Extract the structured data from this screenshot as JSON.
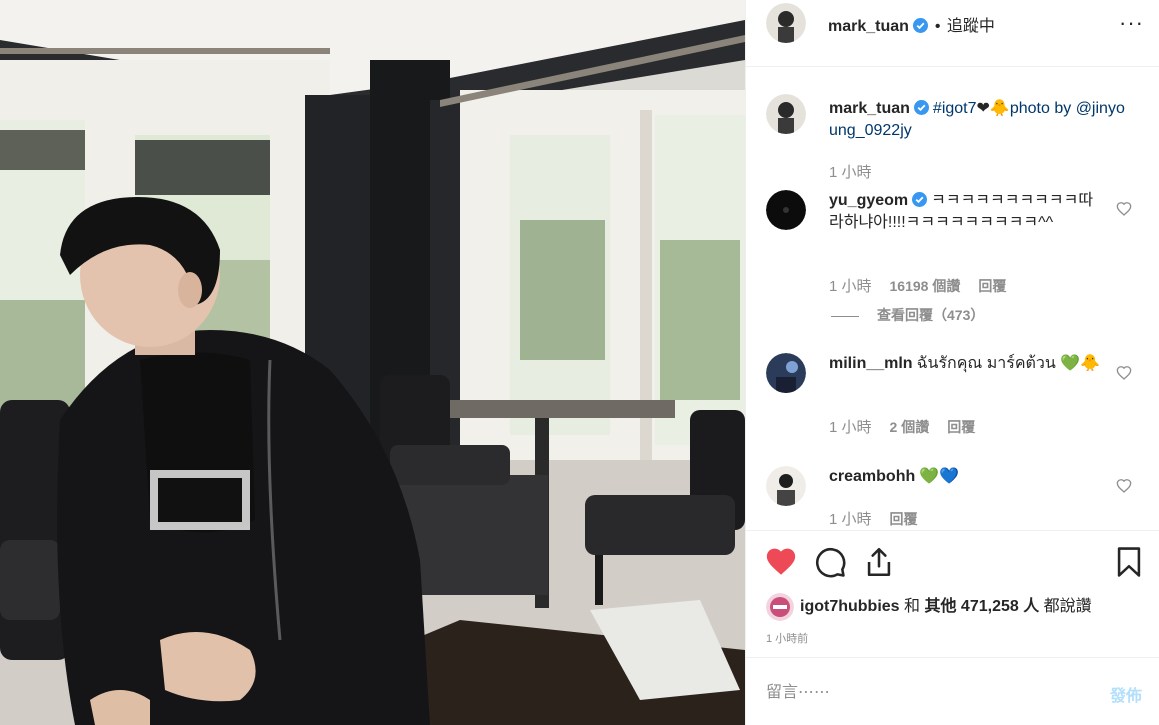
{
  "colors": {
    "like_red": "#ed4956",
    "verified_blue": "#3897f0",
    "link_blue": "#00376b",
    "muted_gray": "#8e8e8e",
    "post_button_disabled": "#b2dffc"
  },
  "photo": {
    "icon": "photo-of-man-in-cafe"
  },
  "header": {
    "username": "mark_tuan",
    "separator": "•",
    "follow_status": "追蹤中",
    "more_icon": "ellipsis-icon",
    "more_label": "···"
  },
  "caption": {
    "username": "mark_tuan",
    "hashtag": "#igot7",
    "emoji": "❤🐥",
    "text": "photo by",
    "mention": "@jinyoung_0922jy",
    "time": "1 小時"
  },
  "comments": [
    {
      "username": "yu_gyeom",
      "verified": true,
      "text": "ㅋㅋㅋㅋㅋㅋㅋㅋㅋㅋ따라하냐아!!!!ㅋㅋㅋㅋㅋㅋㅋㅋㅋ^^",
      "time": "1 小時",
      "likes": "16198 個讚",
      "reply": "回覆",
      "view_replies": "查看回覆（473）"
    },
    {
      "username": "milin__mln",
      "verified": false,
      "text": "ฉันรักคุณ มาร์คต้วน 💚🐥",
      "time": "1 小時",
      "likes": "2 個讚",
      "reply": "回覆"
    },
    {
      "username": "creambohh",
      "verified": false,
      "text": "💚💙",
      "time": "1 小時",
      "reply": "回覆"
    }
  ],
  "actions": {
    "like_icon": "heart-filled-icon",
    "comment_icon": "comment-bubble-icon",
    "share_icon": "share-icon",
    "save_icon": "bookmark-icon"
  },
  "likes": {
    "username": "igot7hubbies",
    "connector": "和",
    "others": "其他 471,258 人",
    "suffix": "都說讚"
  },
  "post_time": "1 小時前",
  "comment_box": {
    "placeholder": "留言⋯⋯",
    "post_label": "發佈"
  }
}
